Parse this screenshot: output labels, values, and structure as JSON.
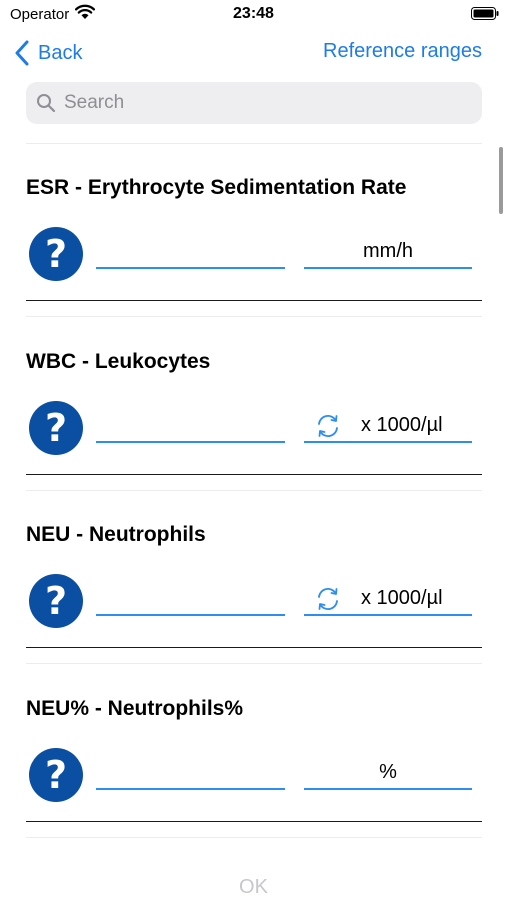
{
  "status_bar": {
    "carrier": "Operator",
    "time": "23:48",
    "wifi_icon": "wifi-icon",
    "battery_icon": "battery-icon"
  },
  "nav": {
    "back_label": "Back",
    "reference_label": "Reference ranges",
    "accent_color": "#1e7ce8"
  },
  "search": {
    "placeholder": "Search",
    "value": ""
  },
  "tests": [
    {
      "title": "ESR - Erythrocyte Sedimentation Rate",
      "value": "",
      "unit": "mm/h",
      "has_unit_switch": false
    },
    {
      "title": "WBC - Leukocytes",
      "value": "",
      "unit": "x 1000/µl",
      "has_unit_switch": true
    },
    {
      "title": "NEU - Neutrophils",
      "value": "",
      "unit": "x 1000/µl",
      "has_unit_switch": true
    },
    {
      "title": "NEU% - Neutrophils%",
      "value": "",
      "unit": "%",
      "has_unit_switch": false
    }
  ],
  "footer": {
    "ok_label": "OK",
    "ok_enabled": false
  },
  "colors": {
    "help_icon": "#0b4fa3",
    "input_underline": "#2d8ef0",
    "disabled": "#c7c7cc"
  }
}
